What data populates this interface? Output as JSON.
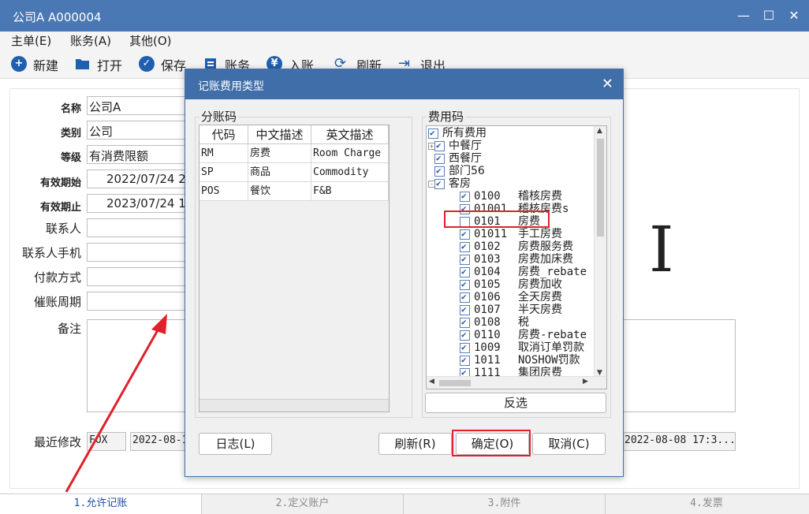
{
  "window": {
    "title": "公司A  A000004"
  },
  "menu": [
    "主单(E)",
    "账务(A)",
    "其他(O)"
  ],
  "toolbar": {
    "new": "新建",
    "open": "打开",
    "save": "保存",
    "account": "账务",
    "checkin": "入账",
    "refresh": "刷新",
    "exit": "退出"
  },
  "form": {
    "name_label": "名称",
    "name": "公司A",
    "type_label": "类别",
    "type": "公司",
    "level_label": "等级",
    "level": "有消费限额",
    "valid_from_label": "有效期始",
    "valid_from": "2022/07/24 2",
    "valid_to_label": "有效期止",
    "valid_to": "2023/07/24 1",
    "contact_label": "联系人",
    "contact_phone_label": "联系人手机",
    "payment_label": "付款方式",
    "dunning_label": "催账周期",
    "note_label": "备注",
    "last_modified_label": "最近修改",
    "modifier": "FOX",
    "modified_time_left": "2022-08-1",
    "modified_time_right": "2022-08-08 17:3..."
  },
  "tabs": [
    "1.允许记账",
    "2.定义账户",
    "3.附件",
    "4.发票"
  ],
  "dialog": {
    "title": "记账费用类型",
    "ledger_group": "分账码",
    "fee_group": "费用码",
    "columns": [
      "代码",
      "中文描述",
      "英文描述"
    ],
    "rows": [
      [
        "RM",
        "房费",
        "Room Charge"
      ],
      [
        "SP",
        "商品",
        "Commodity"
      ],
      [
        "POS",
        "餐饮",
        "F&B"
      ]
    ],
    "tree": [
      {
        "level": 0,
        "code": "所有费用",
        "desc": "",
        "checked": true,
        "expander": ""
      },
      {
        "level": 1,
        "code": "中餐厅",
        "desc": "",
        "checked": true,
        "expander": "+"
      },
      {
        "level": 1,
        "code": "西餐厅",
        "desc": "",
        "checked": true,
        "expander": ""
      },
      {
        "level": 1,
        "code": "部门56",
        "desc": "",
        "checked": true,
        "expander": ""
      },
      {
        "level": 1,
        "code": "客房",
        "desc": "",
        "checked": true,
        "expander": "-"
      },
      {
        "level": 2,
        "code": "0100",
        "desc": "稽核房费",
        "checked": true
      },
      {
        "level": 2,
        "code": "01001",
        "desc": "稽核房费s",
        "checked": true
      },
      {
        "level": 2,
        "code": "0101",
        "desc": "房费",
        "checked": false
      },
      {
        "level": 2,
        "code": "01011",
        "desc": "手工房费",
        "checked": true
      },
      {
        "level": 2,
        "code": "0102",
        "desc": "房费服务费",
        "checked": true
      },
      {
        "level": 2,
        "code": "0103",
        "desc": "房费加床费",
        "checked": true
      },
      {
        "level": 2,
        "code": "0104",
        "desc": "房费_rebate",
        "checked": true
      },
      {
        "level": 2,
        "code": "0105",
        "desc": "房费加收",
        "checked": true
      },
      {
        "level": 2,
        "code": "0106",
        "desc": "全天房费",
        "checked": true
      },
      {
        "level": 2,
        "code": "0107",
        "desc": "半天房费",
        "checked": true
      },
      {
        "level": 2,
        "code": "0108",
        "desc": "税",
        "checked": true
      },
      {
        "level": 2,
        "code": "0110",
        "desc": "房费-rebate",
        "checked": true
      },
      {
        "level": 2,
        "code": "1009",
        "desc": "取消订单罚款",
        "checked": true
      },
      {
        "level": 2,
        "code": "1011",
        "desc": "NOSHOW罚款",
        "checked": true
      },
      {
        "level": 2,
        "code": "1111",
        "desc": "集团房费",
        "checked": true
      }
    ],
    "invert_button": "反选",
    "log_button": "日志(L)",
    "refresh_button": "刷新(R)",
    "ok_button": "确定(O)",
    "cancel_button": "取消(C)"
  },
  "colors": {
    "titlebar": "#4a78b4",
    "dialog_title": "#3f6ea8",
    "highlight": "#e0202a",
    "active_tab": "#1f4fa5"
  }
}
